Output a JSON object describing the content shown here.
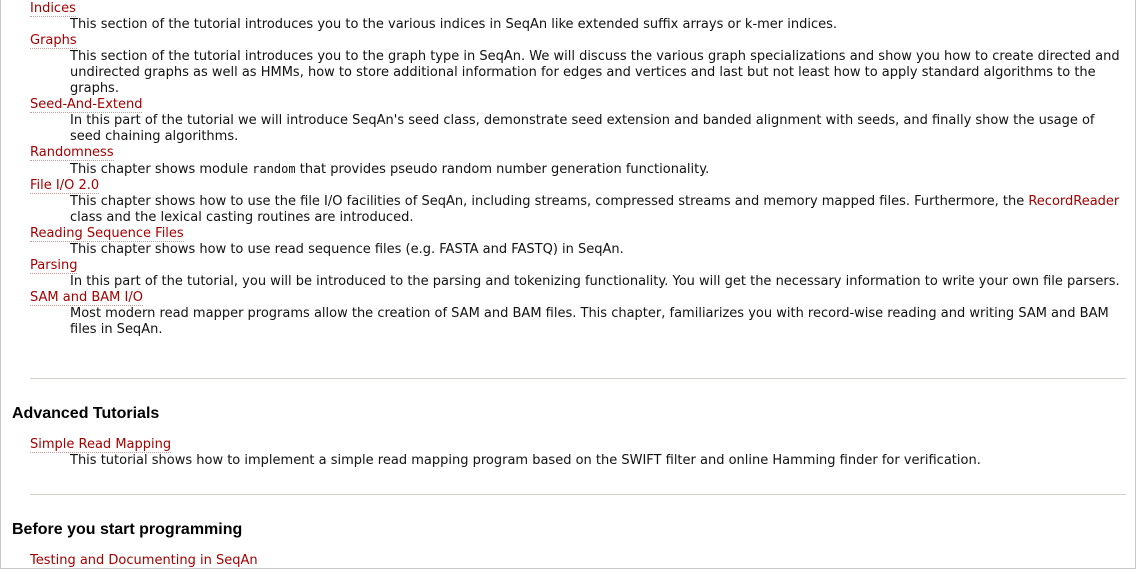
{
  "tutorial_list": [
    {
      "term": "Indices",
      "desc": "This section of the tutorial introduces you to the various indices in SeqAn like extended suffix arrays or k-mer indices."
    },
    {
      "term": "Graphs",
      "desc": "This section of the tutorial introduces you to the graph type in SeqAn. We will discuss the various graph specializations and show you how to create directed and undirected graphs as well as HMMs, how to store additional information for edges and vertices and last but not least how to apply standard algorithms to the graphs."
    },
    {
      "term": "Seed-And-Extend",
      "desc": "In this part of the tutorial we will introduce SeqAn's seed class, demonstrate seed extension and banded alignment with seeds, and finally show the usage of seed chaining algorithms."
    },
    {
      "term": "Randomness",
      "desc_pre": "This chapter shows module ",
      "desc_code": "random",
      "desc_post": " that provides pseudo random number generation functionality."
    },
    {
      "term": "File I/O 2.0",
      "desc_pre": "This chapter shows how to use the file I/O facilities of SeqAn, including streams, compressed streams and memory mapped files. Furthermore, the ",
      "desc_link": "RecordReader",
      "desc_post": " class and the lexical casting routines are introduced."
    },
    {
      "term": "Reading Sequence Files",
      "desc": "This chapter shows how to use read sequence files (e.g. FASTA and FASTQ) in SeqAn."
    },
    {
      "term": "Parsing",
      "desc": "In this part of the tutorial, you will be introduced to the parsing and tokenizing functionality. You will get the necessary information to write your own file parsers."
    },
    {
      "term": "SAM and BAM I/O",
      "desc": "Most modern read mapper programs allow the creation of SAM and BAM files. This chapter, familiarizes you with record-wise reading and writing SAM and BAM files in SeqAn."
    }
  ],
  "advanced": {
    "heading": "Advanced Tutorials",
    "items": [
      {
        "term": "Simple Read Mapping",
        "desc": "This tutorial shows how to implement a simple read mapping program based on the SWIFT filter and online Hamming finder for verification."
      }
    ]
  },
  "before": {
    "heading": "Before you start programming",
    "items": [
      {
        "term": "Testing and Documenting in SeqAn"
      }
    ]
  },
  "colors": {
    "link": "#a40000",
    "text": "#111111",
    "rule": "#d2d2cc"
  }
}
